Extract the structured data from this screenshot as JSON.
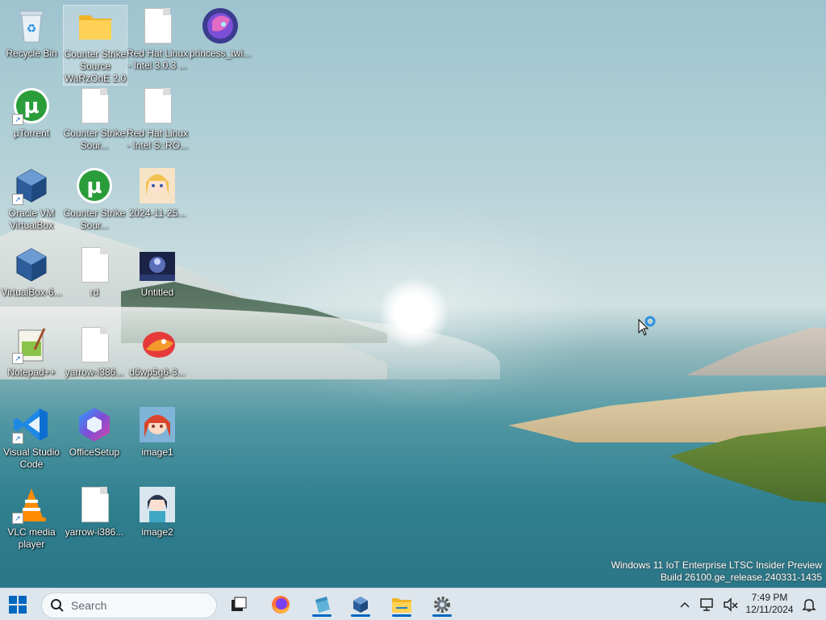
{
  "desktop": {
    "icons": [
      {
        "label": "Recycle Bin"
      },
      {
        "label": "Counter Strike Source WaRzOnE 2.0"
      },
      {
        "label": "Red Hat Linux - Intel 3.0.3 ..."
      },
      {
        "label": "princess_twi..."
      },
      {
        "label": "µTorrent"
      },
      {
        "label": "Counter Strike Sour..."
      },
      {
        "label": "Red Hat Linux - Intel S::RO..."
      },
      {
        "label": "Oracle VM VirtualBox"
      },
      {
        "label": "Counter Strike Sour..."
      },
      {
        "label": "2024-11-25..."
      },
      {
        "label": "VirtualBox-6..."
      },
      {
        "label": "rd"
      },
      {
        "label": "Untitled"
      },
      {
        "label": "Notepad++"
      },
      {
        "label": "yarrow-i386..."
      },
      {
        "label": "d6wp5g6-3..."
      },
      {
        "label": "Visual Studio Code"
      },
      {
        "label": "OfficeSetup"
      },
      {
        "label": "image1"
      },
      {
        "label": "VLC media player"
      },
      {
        "label": "yarrow-i386..."
      },
      {
        "label": "image2"
      }
    ]
  },
  "watermark": {
    "line1": "Windows 11 IoT Enterprise LTSC Insider Preview",
    "line2": "Build 26100.ge_release.240331-1435"
  },
  "taskbar": {
    "search_placeholder": "Search",
    "time": "7:49 PM",
    "date": "12/11/2024"
  },
  "colors": {
    "taskbar_bg": "#dde6ec",
    "accent": "#0067c0"
  }
}
